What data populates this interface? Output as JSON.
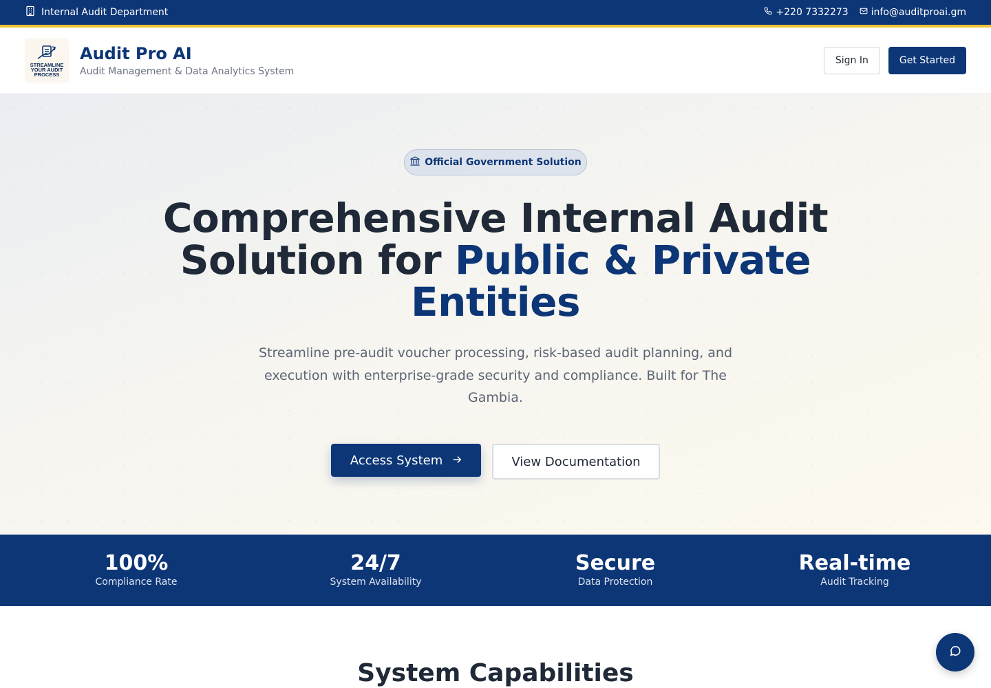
{
  "topbar": {
    "department": "Internal Audit Department",
    "phone": "+220 7332273",
    "email": "info@auditproai.gm"
  },
  "header": {
    "logo_text": "STREAMLINE YOUR AUDIT PROCESS",
    "brand_title": "Audit Pro AI",
    "brand_subtitle": "Audit Management & Data Analytics System",
    "signin_label": "Sign In",
    "get_started_label": "Get Started"
  },
  "hero": {
    "badge": "Official Government Solution",
    "title_line1": "Comprehensive Internal Audit",
    "title_line2a": "Solution for ",
    "title_highlight": "Public & Private Entities",
    "description": "Streamline pre-audit voucher processing, risk-based audit planning, and execution with enterprise-grade security and compliance. Built for The Gambia.",
    "access_label": "Access System",
    "docs_label": "View Documentation"
  },
  "stats": [
    {
      "value": "100%",
      "label": "Compliance Rate"
    },
    {
      "value": "24/7",
      "label": "System Availability"
    },
    {
      "value": "Secure",
      "label": "Data Protection"
    },
    {
      "value": "Real-time",
      "label": "Audit Tracking"
    }
  ],
  "capabilities": {
    "title": "System Capabilities"
  },
  "colors": {
    "primary": "#0d3677",
    "accent": "#f1c232"
  },
  "icons": {
    "department": "building-icon",
    "phone": "phone-icon",
    "email": "mail-icon",
    "badge": "landmark-icon",
    "access_arrow": "arrow-right-icon",
    "chat": "chat-bubble-icon"
  }
}
